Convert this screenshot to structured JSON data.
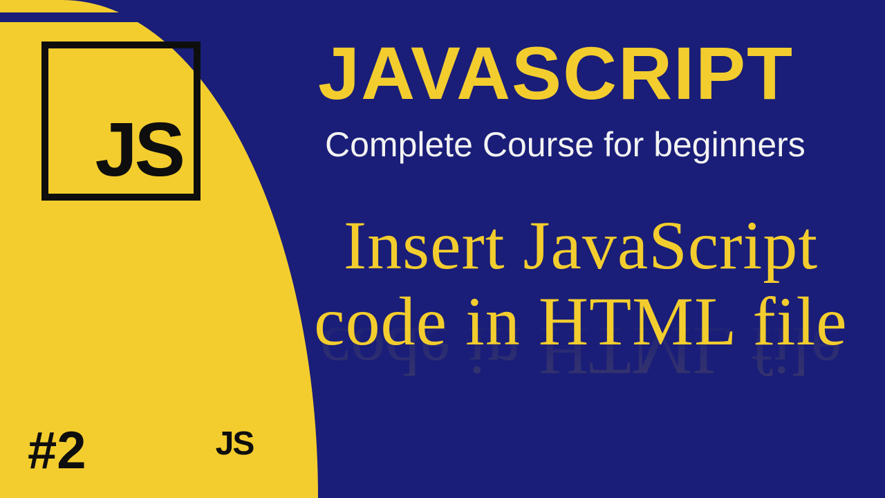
{
  "logo": {
    "js": "JS"
  },
  "episode": "#2",
  "badge": {
    "js": "JS"
  },
  "heading": {
    "main": "JAVASCRIPT",
    "sub": "Complete Course for beginners"
  },
  "topic": {
    "line1": "Insert JavaScript",
    "line2": "code in HTML file",
    "reflection": "code in HTML file"
  }
}
